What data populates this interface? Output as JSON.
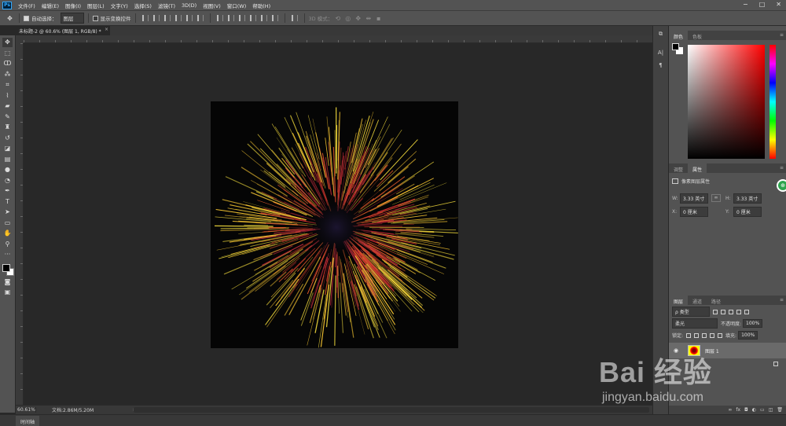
{
  "menubar": {
    "logo": "Ps",
    "items": [
      "文件(F)",
      "编辑(E)",
      "图像(I)",
      "图层(L)",
      "文字(Y)",
      "选择(S)",
      "滤镜(T)",
      "3D(D)",
      "视图(V)",
      "窗口(W)",
      "帮助(H)"
    ],
    "window_controls": [
      "−",
      "□",
      "✕"
    ]
  },
  "options": {
    "auto_select_label": "自动选择：",
    "auto_select_value": "图层",
    "show_transform_label": "显示变换控件",
    "mode_3d_label": "3D 模式："
  },
  "document": {
    "tab_title": "未标题-2 @ 60.6% (图层 1, RGB/8) *",
    "close": "×"
  },
  "status": {
    "zoom": "60.61%",
    "doc_info": "文档:2.86M/5.20M",
    "arrow": "›"
  },
  "timeline": {
    "label": "时间轴"
  },
  "color_panel": {
    "tabs": [
      "颜色",
      "色板"
    ],
    "accent": "#ff0000"
  },
  "properties_panel": {
    "tabs": [
      "调整",
      "属性"
    ],
    "heading": "像素图层属性",
    "w_label": "W:",
    "w_value": "3.33 英寸",
    "h_label": "H:",
    "h_value": "3.33 英寸",
    "x_label": "X:",
    "x_value": "0 厘米",
    "y_label": "Y:",
    "y_value": "0 厘米",
    "link_icon": "∞"
  },
  "layers_panel": {
    "tabs": [
      "图层",
      "通道",
      "路径"
    ],
    "filter_value": "ρ 类型",
    "blend_mode": "柔光",
    "opacity_label": "不透明度:",
    "opacity_value": "100%",
    "lock_label": "锁定:",
    "fill_label": "填充:",
    "fill_value": "100%",
    "layer_name": "图层 1",
    "footer_icons": [
      "∞",
      "fx",
      "◘",
      "◐",
      "▭",
      "◫",
      "🗑"
    ]
  },
  "watermark": {
    "logo": "Bai 经验",
    "url": "jingyan.baidu.com"
  }
}
